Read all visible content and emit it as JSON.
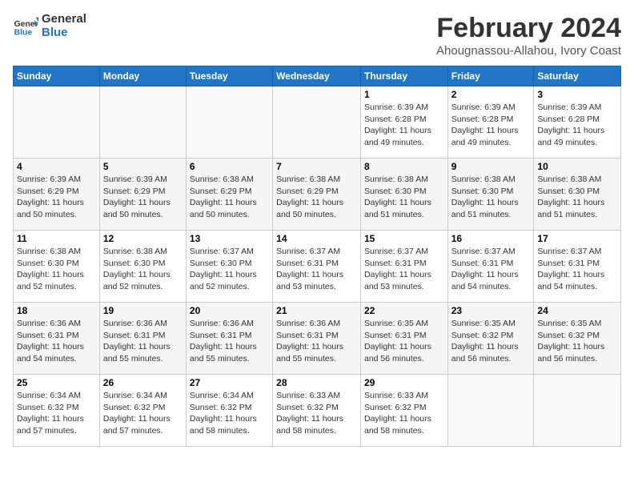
{
  "logo": {
    "line1": "General",
    "line2": "Blue"
  },
  "title": "February 2024",
  "location": "Ahougnassou-Allahou, Ivory Coast",
  "days_of_week": [
    "Sunday",
    "Monday",
    "Tuesday",
    "Wednesday",
    "Thursday",
    "Friday",
    "Saturday"
  ],
  "weeks": [
    [
      {
        "day": "",
        "info": ""
      },
      {
        "day": "",
        "info": ""
      },
      {
        "day": "",
        "info": ""
      },
      {
        "day": "",
        "info": ""
      },
      {
        "day": "1",
        "info": "Sunrise: 6:39 AM\nSunset: 6:28 PM\nDaylight: 11 hours\nand 49 minutes."
      },
      {
        "day": "2",
        "info": "Sunrise: 6:39 AM\nSunset: 6:28 PM\nDaylight: 11 hours\nand 49 minutes."
      },
      {
        "day": "3",
        "info": "Sunrise: 6:39 AM\nSunset: 6:28 PM\nDaylight: 11 hours\nand 49 minutes."
      }
    ],
    [
      {
        "day": "4",
        "info": "Sunrise: 6:39 AM\nSunset: 6:29 PM\nDaylight: 11 hours\nand 50 minutes."
      },
      {
        "day": "5",
        "info": "Sunrise: 6:39 AM\nSunset: 6:29 PM\nDaylight: 11 hours\nand 50 minutes."
      },
      {
        "day": "6",
        "info": "Sunrise: 6:38 AM\nSunset: 6:29 PM\nDaylight: 11 hours\nand 50 minutes."
      },
      {
        "day": "7",
        "info": "Sunrise: 6:38 AM\nSunset: 6:29 PM\nDaylight: 11 hours\nand 50 minutes."
      },
      {
        "day": "8",
        "info": "Sunrise: 6:38 AM\nSunset: 6:30 PM\nDaylight: 11 hours\nand 51 minutes."
      },
      {
        "day": "9",
        "info": "Sunrise: 6:38 AM\nSunset: 6:30 PM\nDaylight: 11 hours\nand 51 minutes."
      },
      {
        "day": "10",
        "info": "Sunrise: 6:38 AM\nSunset: 6:30 PM\nDaylight: 11 hours\nand 51 minutes."
      }
    ],
    [
      {
        "day": "11",
        "info": "Sunrise: 6:38 AM\nSunset: 6:30 PM\nDaylight: 11 hours\nand 52 minutes."
      },
      {
        "day": "12",
        "info": "Sunrise: 6:38 AM\nSunset: 6:30 PM\nDaylight: 11 hours\nand 52 minutes."
      },
      {
        "day": "13",
        "info": "Sunrise: 6:37 AM\nSunset: 6:30 PM\nDaylight: 11 hours\nand 52 minutes."
      },
      {
        "day": "14",
        "info": "Sunrise: 6:37 AM\nSunset: 6:31 PM\nDaylight: 11 hours\nand 53 minutes."
      },
      {
        "day": "15",
        "info": "Sunrise: 6:37 AM\nSunset: 6:31 PM\nDaylight: 11 hours\nand 53 minutes."
      },
      {
        "day": "16",
        "info": "Sunrise: 6:37 AM\nSunset: 6:31 PM\nDaylight: 11 hours\nand 54 minutes."
      },
      {
        "day": "17",
        "info": "Sunrise: 6:37 AM\nSunset: 6:31 PM\nDaylight: 11 hours\nand 54 minutes."
      }
    ],
    [
      {
        "day": "18",
        "info": "Sunrise: 6:36 AM\nSunset: 6:31 PM\nDaylight: 11 hours\nand 54 minutes."
      },
      {
        "day": "19",
        "info": "Sunrise: 6:36 AM\nSunset: 6:31 PM\nDaylight: 11 hours\nand 55 minutes."
      },
      {
        "day": "20",
        "info": "Sunrise: 6:36 AM\nSunset: 6:31 PM\nDaylight: 11 hours\nand 55 minutes."
      },
      {
        "day": "21",
        "info": "Sunrise: 6:36 AM\nSunset: 6:31 PM\nDaylight: 11 hours\nand 55 minutes."
      },
      {
        "day": "22",
        "info": "Sunrise: 6:35 AM\nSunset: 6:31 PM\nDaylight: 11 hours\nand 56 minutes."
      },
      {
        "day": "23",
        "info": "Sunrise: 6:35 AM\nSunset: 6:32 PM\nDaylight: 11 hours\nand 56 minutes."
      },
      {
        "day": "24",
        "info": "Sunrise: 6:35 AM\nSunset: 6:32 PM\nDaylight: 11 hours\nand 56 minutes."
      }
    ],
    [
      {
        "day": "25",
        "info": "Sunrise: 6:34 AM\nSunset: 6:32 PM\nDaylight: 11 hours\nand 57 minutes."
      },
      {
        "day": "26",
        "info": "Sunrise: 6:34 AM\nSunset: 6:32 PM\nDaylight: 11 hours\nand 57 minutes."
      },
      {
        "day": "27",
        "info": "Sunrise: 6:34 AM\nSunset: 6:32 PM\nDaylight: 11 hours\nand 58 minutes."
      },
      {
        "day": "28",
        "info": "Sunrise: 6:33 AM\nSunset: 6:32 PM\nDaylight: 11 hours\nand 58 minutes."
      },
      {
        "day": "29",
        "info": "Sunrise: 6:33 AM\nSunset: 6:32 PM\nDaylight: 11 hours\nand 58 minutes."
      },
      {
        "day": "",
        "info": ""
      },
      {
        "day": "",
        "info": ""
      }
    ]
  ]
}
